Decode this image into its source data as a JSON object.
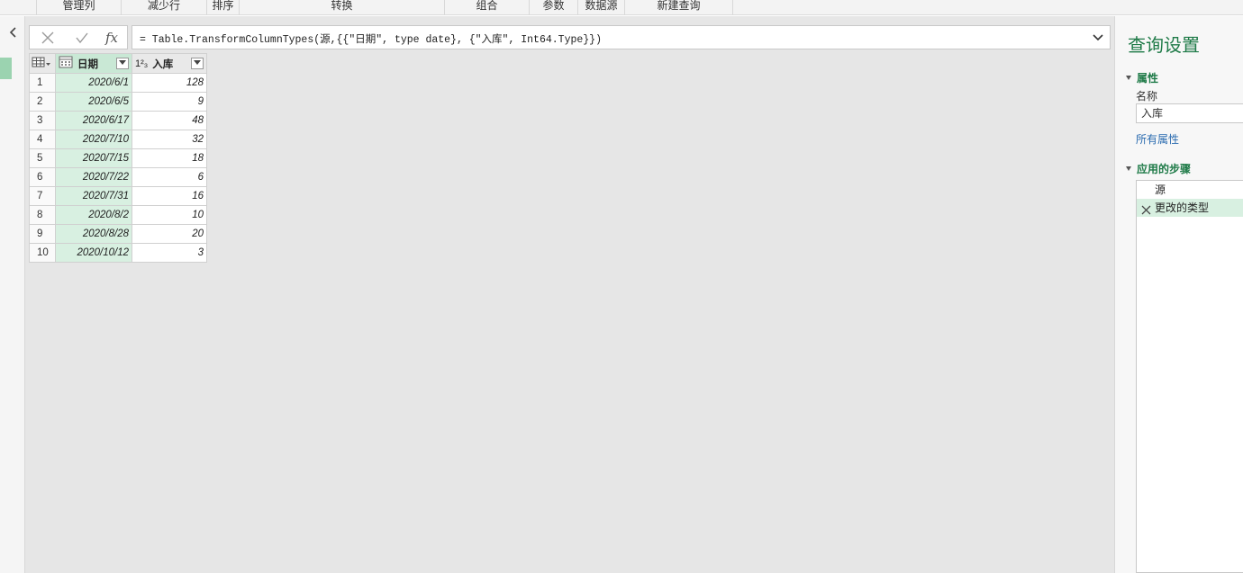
{
  "ribbon": {
    "groups": [
      "管理列",
      "减少行",
      "排序",
      "转换",
      "组合",
      "参数",
      "数据源",
      "新建查询"
    ]
  },
  "formula_bar": {
    "cancel_icon": "close-icon",
    "commit_icon": "check-icon",
    "fx_label": "fx",
    "formula": "= Table.TransformColumnTypes(源,{{\"日期\", type date}, {\"入库\", Int64.Type}})"
  },
  "table": {
    "columns": [
      {
        "name": "日期",
        "type_icon": "calendar-icon"
      },
      {
        "name": "入库",
        "type_icon": "1²₃"
      }
    ],
    "rows": [
      {
        "n": "1",
        "date": "2020/6/1",
        "qty": "128"
      },
      {
        "n": "2",
        "date": "2020/6/5",
        "qty": "9"
      },
      {
        "n": "3",
        "date": "2020/6/17",
        "qty": "48"
      },
      {
        "n": "4",
        "date": "2020/7/10",
        "qty": "32"
      },
      {
        "n": "5",
        "date": "2020/7/15",
        "qty": "18"
      },
      {
        "n": "6",
        "date": "2020/7/22",
        "qty": "6"
      },
      {
        "n": "7",
        "date": "2020/7/31",
        "qty": "16"
      },
      {
        "n": "8",
        "date": "2020/8/2",
        "qty": "10"
      },
      {
        "n": "9",
        "date": "2020/8/28",
        "qty": "20"
      },
      {
        "n": "10",
        "date": "2020/10/12",
        "qty": "3"
      }
    ]
  },
  "settings": {
    "title": "查询设置",
    "properties_header": "属性",
    "name_label": "名称",
    "name_value": "入库",
    "all_properties_link": "所有属性",
    "steps_header": "应用的步骤",
    "steps": [
      {
        "label": "源",
        "selected": false
      },
      {
        "label": "更改的类型",
        "selected": true
      }
    ]
  },
  "colors": {
    "accent_green": "#1e7a47",
    "selected_column": "#d8f0e1",
    "link_blue": "#2b6cb0"
  }
}
